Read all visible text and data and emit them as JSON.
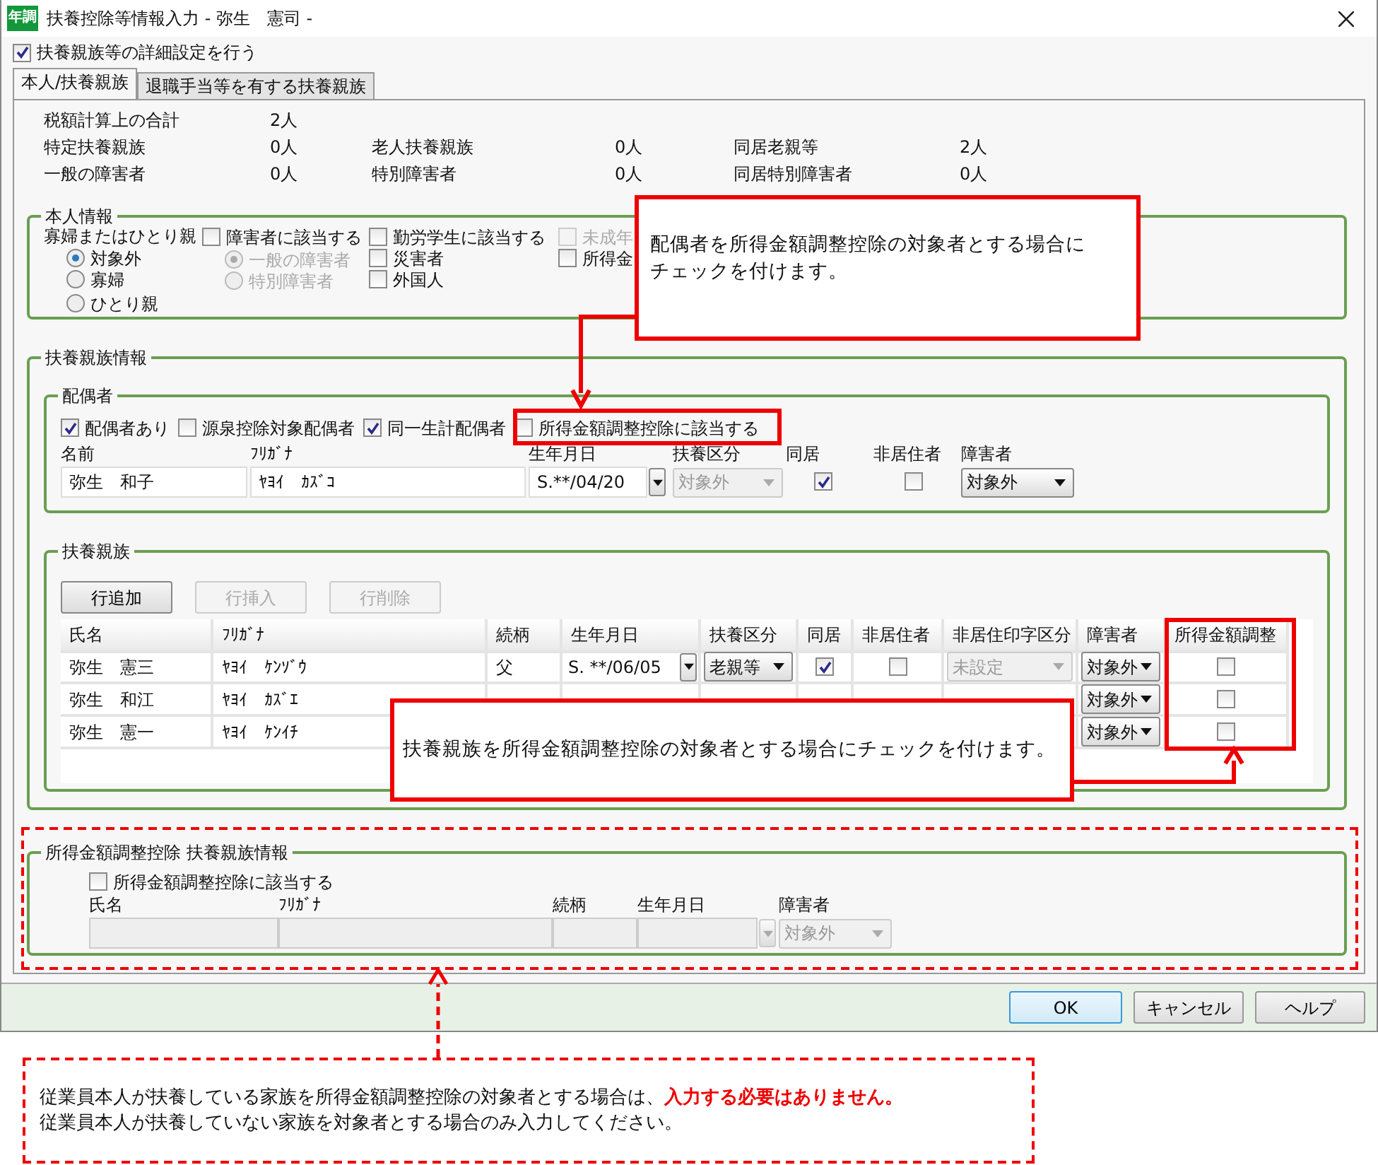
{
  "window": {
    "app_icon_text": "年調",
    "title": "扶養控除等情報入力 - 弥生　憲司 -"
  },
  "detail_setting": {
    "label": "扶養親族等の詳細設定を行う",
    "checked": true
  },
  "tabs": [
    {
      "label": "本人/扶養親族",
      "selected": true
    },
    {
      "label": "退職手当等を有する扶養親族",
      "selected": false
    }
  ],
  "summary": [
    [
      {
        "label": "税額計算上の合計",
        "value": "2人"
      }
    ],
    [
      {
        "label": "特定扶養親族",
        "value": "0人"
      },
      {
        "label": "老人扶養親族",
        "value": "0人"
      },
      {
        "label": "同居老親等",
        "value": "2人"
      }
    ],
    [
      {
        "label": "一般の障害者",
        "value": "0人"
      },
      {
        "label": "特別障害者",
        "value": "0人"
      },
      {
        "label": "同居特別障害者",
        "value": "0人"
      }
    ]
  ],
  "personal": {
    "title": "本人情報",
    "widow_label": "寡婦またはひとり親",
    "widow_options": [
      {
        "label": "対象外",
        "selected": true
      },
      {
        "label": "寡婦",
        "selected": false
      },
      {
        "label": "ひとり親",
        "selected": false
      }
    ],
    "disability": {
      "label": "障害者に該当する",
      "checked": false
    },
    "disability_options": [
      {
        "label": "一般の障害者",
        "selected": true,
        "disabled": true
      },
      {
        "label": "特別障害者",
        "selected": false,
        "disabled": true
      }
    ],
    "checks": [
      {
        "label": "勤労学生に該当する",
        "checked": false,
        "disabled": false
      },
      {
        "label": "災害者",
        "checked": false,
        "disabled": false
      },
      {
        "label": "外国人",
        "checked": false,
        "disabled": false
      },
      {
        "label": "未成年",
        "checked": false,
        "disabled": true
      },
      {
        "label": "所得金",
        "checked": false,
        "disabled": false
      }
    ]
  },
  "dependents_info": {
    "title": "扶養親族情報",
    "spouse": {
      "title": "配偶者",
      "checks": [
        {
          "label": "配偶者あり",
          "checked": true
        },
        {
          "label": "源泉控除対象配偶者",
          "checked": false
        },
        {
          "label": "同一生計配偶者",
          "checked": true
        },
        {
          "label": "所得金額調整控除に該当する",
          "checked": false
        }
      ],
      "columns": [
        "名前",
        "ﾌﾘｶﾞﾅ",
        "生年月日",
        "扶養区分",
        "同居",
        "非居住者",
        "障害者"
      ],
      "name": "弥生　和子",
      "kana": "ﾔﾖｲ　ｶｽﾞｺ",
      "birth": "S.**/04/20",
      "dependent_type": {
        "value": "対象外",
        "disabled": true
      },
      "cohabit": {
        "checked": true
      },
      "nonresident": {
        "checked": false
      },
      "disability": {
        "value": "対象外",
        "disabled": false
      }
    },
    "dependents": {
      "title": "扶養親族",
      "buttons": [
        {
          "label": "行追加",
          "disabled": false
        },
        {
          "label": "行挿入",
          "disabled": true
        },
        {
          "label": "行削除",
          "disabled": true
        }
      ],
      "columns": [
        "氏名",
        "ﾌﾘｶﾞﾅ",
        "続柄",
        "生年月日",
        "扶養区分",
        "同居",
        "非居住者",
        "非居住印字区分",
        "障害者",
        "所得金額調整"
      ],
      "rows": [
        {
          "name": "弥生　憲三",
          "kana": "ﾔﾖｲ　ｹﾝｿﾞｳ",
          "relation": "父",
          "birth": "S. **/06/05",
          "dependent_type": {
            "value": "老親等",
            "disabled": false
          },
          "cohabit": {
            "checked": true
          },
          "nonresident": {
            "checked": false
          },
          "print_type": {
            "value": "未設定",
            "disabled": true
          },
          "disability": {
            "value": "対象外",
            "disabled": false
          },
          "income_adjustment": {
            "checked": false
          }
        },
        {
          "name": "弥生　和江",
          "kana": "ﾔﾖｲ　ｶｽﾞｴ",
          "disability": {
            "value": "対象外",
            "disabled": false
          },
          "income_adjustment": {
            "checked": false
          }
        },
        {
          "name": "弥生　憲一",
          "kana": "ﾔﾖｲ　ｹﾝｲﾁ",
          "disability": {
            "value": "対象外",
            "disabled": false
          },
          "income_adjustment": {
            "checked": false
          }
        }
      ]
    }
  },
  "income_adjustment_info": {
    "title": "所得金額調整控除 扶養親族情報",
    "check": {
      "label": "所得金額調整控除に該当する",
      "checked": false
    },
    "columns": [
      "氏名",
      "ﾌﾘｶﾞﾅ",
      "続柄",
      "生年月日",
      "障害者"
    ],
    "disability": {
      "value": "対象外",
      "disabled": true
    }
  },
  "buttons": [
    {
      "label": "OK",
      "default": true
    },
    {
      "label": "キャンセル",
      "default": false
    },
    {
      "label": "ヘルプ",
      "default": false
    }
  ],
  "callouts": [
    {
      "text": "配偶者を所得金額調整控除の対象者とする場合にチェックを付けます。"
    },
    {
      "text": "扶養親族を所得金額調整控除の対象者とする場合にチェックを付けます。"
    }
  ],
  "note": {
    "lines": [
      "従業員本人が扶養している家族を所得金額調整控除の対象者とする場合は、**入力する必要はありません。**",
      "従業員本人が扶養していない家族を対象者とする場合のみ入力してください。"
    ]
  }
}
